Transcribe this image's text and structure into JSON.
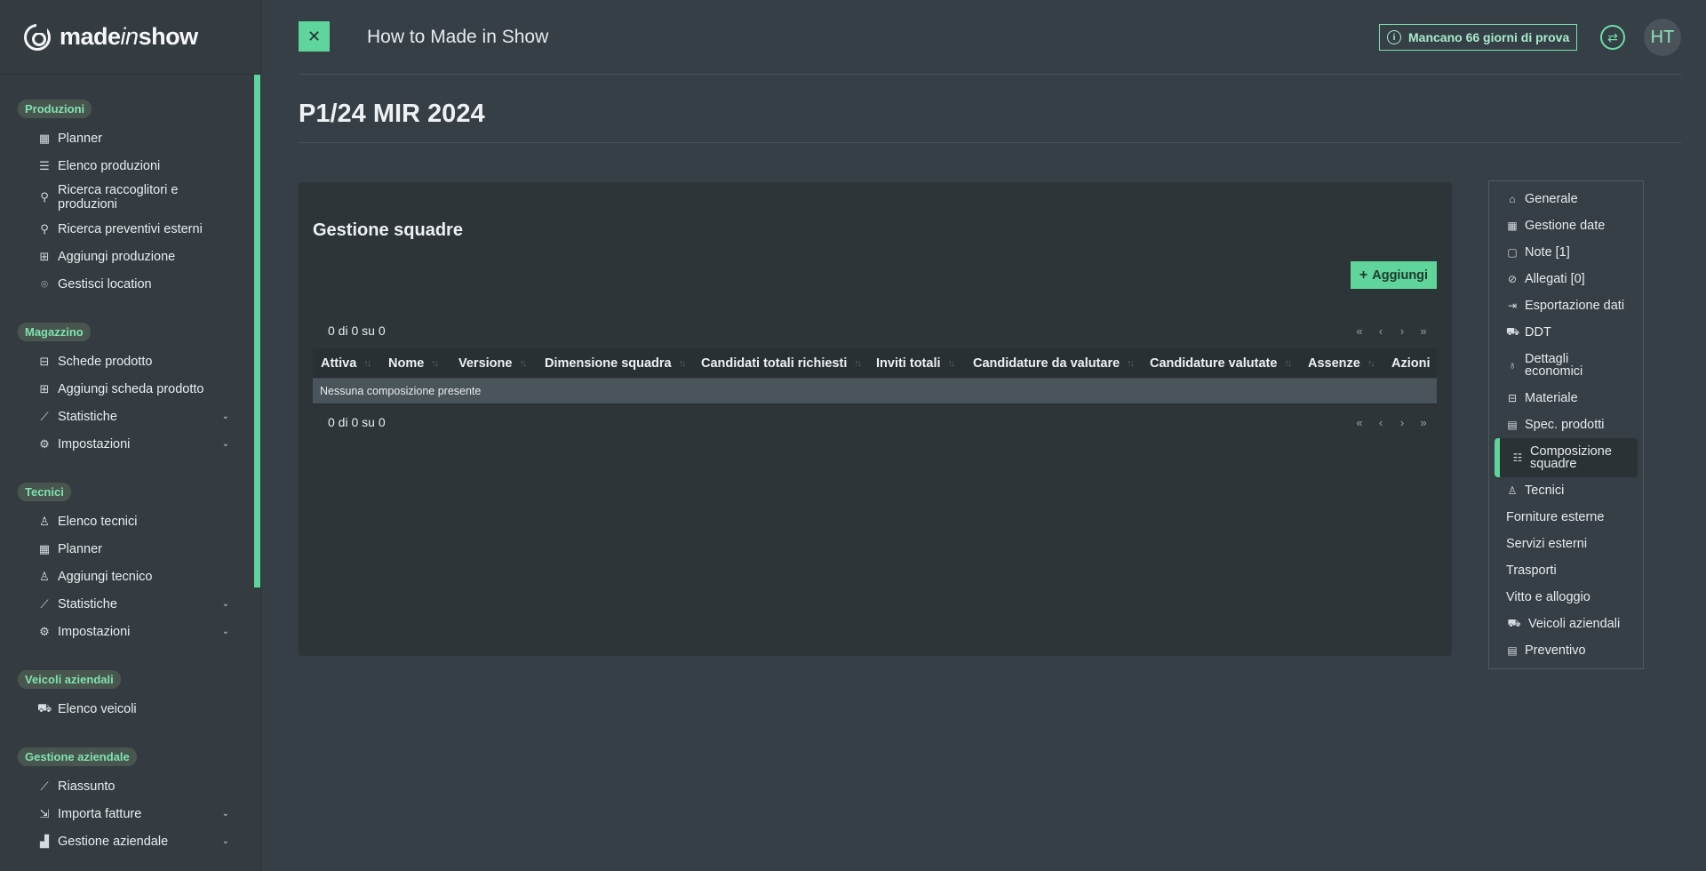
{
  "brand": {
    "part1": "made",
    "part2": "in",
    "part3": "show"
  },
  "header": {
    "title": "How to Made in Show",
    "trial": "Mancano 66 giorni di prova",
    "avatar": "HT"
  },
  "page": {
    "title": "P1/24 MIR 2024"
  },
  "sidebar": {
    "groups": [
      {
        "label": "Produzioni",
        "items": [
          {
            "label": "Planner",
            "icon": "calendar-icon"
          },
          {
            "label": "Elenco produzioni",
            "icon": "list-icon"
          },
          {
            "label": "Ricerca raccoglitori e produzioni",
            "icon": "search-icon"
          },
          {
            "label": "Ricerca preventivi esterni",
            "icon": "search-icon"
          },
          {
            "label": "Aggiungi produzione",
            "icon": "calendar-plus-icon"
          },
          {
            "label": "Gestisci location",
            "icon": "pin-icon"
          }
        ]
      },
      {
        "label": "Magazzino",
        "items": [
          {
            "label": "Schede prodotto",
            "icon": "boxes-icon"
          },
          {
            "label": "Aggiungi scheda prodotto",
            "icon": "plus-square-icon"
          },
          {
            "label": "Statistiche",
            "icon": "chart-icon"
          },
          {
            "label": "Impostazioni",
            "icon": "gear-icon"
          }
        ]
      },
      {
        "label": "Tecnici",
        "items": [
          {
            "label": "Elenco tecnici",
            "icon": "user-icon"
          },
          {
            "label": "Planner",
            "icon": "calendar-icon"
          },
          {
            "label": "Aggiungi tecnico",
            "icon": "user-plus-icon"
          },
          {
            "label": "Statistiche",
            "icon": "chart-icon"
          },
          {
            "label": "Impostazioni",
            "icon": "gear-icon"
          }
        ]
      },
      {
        "label": "Veicoli aziendali",
        "items": [
          {
            "label": "Elenco veicoli",
            "icon": "truck-icon"
          }
        ]
      },
      {
        "label": "Gestione aziendale",
        "items": [
          {
            "label": "Riassunto",
            "icon": "chart-icon"
          },
          {
            "label": "Importa fatture",
            "icon": "import-icon"
          },
          {
            "label": "Gestione aziendale",
            "icon": "chart-bar-icon"
          }
        ]
      }
    ]
  },
  "card": {
    "title": "Gestione squadre",
    "add_label": "Aggiungi",
    "pager_text": "0 di 0 su 0",
    "columns": [
      "Attiva",
      "Nome",
      "Versione",
      "Dimensione squadra",
      "Candidati totali richiesti",
      "Inviti totali",
      "Candidature da valutare",
      "Candidature valutate",
      "Assenze",
      "Azioni"
    ],
    "empty_message": "Nessuna composizione presente"
  },
  "right_nav": [
    {
      "label": "Generale",
      "icon": "tag-icon"
    },
    {
      "label": "Gestione date",
      "icon": "calendar-icon"
    },
    {
      "label": "Note [1]",
      "icon": "note-icon"
    },
    {
      "label": "Allegati [0]",
      "icon": "paperclip-icon"
    },
    {
      "label": "Esportazione dati",
      "icon": "file-export-icon"
    },
    {
      "label": "DDT",
      "icon": "forklift-icon"
    },
    {
      "label": "Dettagli economici",
      "icon": "money-bag-icon"
    },
    {
      "label": "Materiale",
      "icon": "boxes-icon"
    },
    {
      "label": "Spec. prodotti",
      "icon": "file-icon"
    },
    {
      "label": "Composizione squadre",
      "icon": "team-icon"
    },
    {
      "label": "Tecnici",
      "icon": "user-icon"
    },
    {
      "label": "Forniture esterne",
      "icon": ""
    },
    {
      "label": "Servizi esterni",
      "icon": ""
    },
    {
      "label": "Trasporti",
      "icon": ""
    },
    {
      "label": "Vitto e alloggio",
      "icon": ""
    },
    {
      "label": "Veicoli aziendali",
      "icon": "truck-icon"
    },
    {
      "label": "Preventivo",
      "icon": "file-invoice-icon"
    }
  ]
}
